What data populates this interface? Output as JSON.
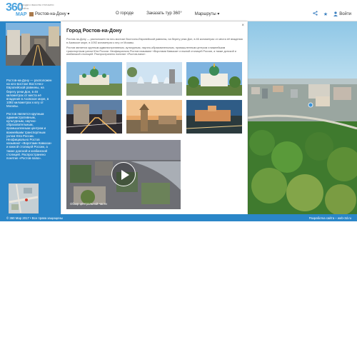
{
  "app": {
    "logo_text": "360",
    "logo_sub": "МАР",
    "tagline": "Города с высоты птичьего полёта"
  },
  "header": {
    "city": "Ростов-на-Дону ▾",
    "nav": [
      "О городе",
      "Заказать тур 360°",
      "Маршруты ▾"
    ],
    "login": "Войти",
    "icons": [
      "share-icon",
      "star-icon",
      "user-icon"
    ]
  },
  "left_panel": {
    "paragraphs": [
      "Ростов-на-Дону — расположен на юго-востоке Восточно-Европейской равнины, на берегу реки Дон, в 46 километрах от места её впадения в Азовское море, в 1092 километрах к югу от Москвы.",
      "Ростов является крупным административным, культурным, научно-образовательным, промышленным центром и важнейшим транспортным узлом Юга России. Неофициально Ростов называют «Воротами Кавказа» и южной столицей России, а также донской и кизбанской столицей. Распространено понятие «Ростов-папа»."
    ]
  },
  "dialog": {
    "close": "×",
    "title": "Город Ростов-на-Дону",
    "paragraphs": [
      "Ростов-на-Дону — расположен на юго-востоке Восточно-Европейской равнины, на берегу реки Дон, в 46 километрах от места её впадения в Азовское море, в 1092 километрах к югу от Москвы.",
      "Ростов является крупным административным, культурным, научно-образовательным, промышленным центром и важнейшим транспортным узлом Юга России. Неофициально Ростов называют «Воротами Кавказа» и южной столицей России, а также донской и кизбанской столицей. Распространено понятие «Ростов-папа»."
    ],
    "video_caption": "Обзор центральной части"
  },
  "footer": {
    "left": "© 360 Мар 2017 • Все права защищены",
    "right": "Разработка сайта – web-3d.ru"
  },
  "colors": {
    "accent": "#2a86c8",
    "logo": "#4aa3df"
  }
}
